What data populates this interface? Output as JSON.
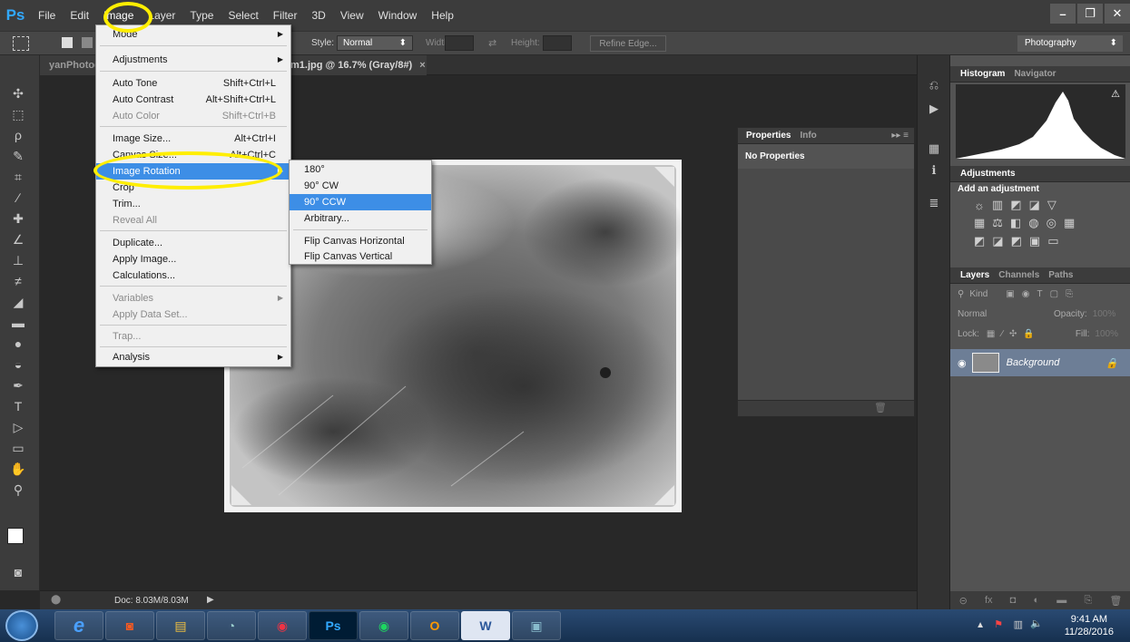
{
  "app": {
    "logo": "Ps"
  },
  "menubar": {
    "items": [
      "File",
      "Edit",
      "Image",
      "Layer",
      "Type",
      "Select",
      "Filter",
      "3D",
      "View",
      "Window",
      "Help"
    ]
  },
  "options": {
    "style_label": "Style:",
    "style_value": "Normal",
    "width_label": "Width:",
    "height_label": "Height:",
    "refine_label": "Refine Edge...",
    "workspace": "Photography"
  },
  "tabs": {
    "left_tab": "yanPhotograp",
    "doc_tab": "m1.jpg @ 16.7% (Gray/8#)"
  },
  "image_menu": {
    "mode": "Mode",
    "adjustments": "Adjustments",
    "auto_tone": "Auto Tone",
    "auto_tone_sc": "Shift+Ctrl+L",
    "auto_contrast": "Auto Contrast",
    "auto_contrast_sc": "Alt+Shift+Ctrl+L",
    "auto_color": "Auto Color",
    "auto_color_sc": "Shift+Ctrl+B",
    "image_size": "Image Size...",
    "image_size_sc": "Alt+Ctrl+I",
    "canvas_size": "Canvas Size...",
    "canvas_size_sc": "Alt+Ctrl+C",
    "image_rotation": "Image Rotation",
    "crop": "Crop",
    "trim": "Trim...",
    "reveal_all": "Reveal All",
    "duplicate": "Duplicate...",
    "apply_image": "Apply Image...",
    "calculations": "Calculations...",
    "variables": "Variables",
    "apply_data_set": "Apply Data Set...",
    "trap": "Trap...",
    "analysis": "Analysis"
  },
  "rotation_submenu": {
    "items": [
      "180°",
      "90° CW",
      "90° CCW",
      "Arbitrary...",
      "Flip Canvas Horizontal",
      "Flip Canvas Vertical"
    ],
    "highlighted": "90° CCW"
  },
  "properties_panel": {
    "tab1": "Properties",
    "tab2": "Info",
    "body": "No Properties"
  },
  "right_panels": {
    "histogram_tab": "Histogram",
    "navigator_tab": "Navigator",
    "adjustments_tab": "Adjustments",
    "adjustments_hint": "Add an adjustment",
    "layers_tab": "Layers",
    "channels_tab": "Channels",
    "paths_tab": "Paths",
    "kind_label": "Kind",
    "blend_mode": "Normal",
    "opacity_label": "Opacity:",
    "opacity_value": "100%",
    "lock_label": "Lock:",
    "fill_label": "Fill:",
    "fill_value": "100%",
    "layer_name": "Background"
  },
  "status": {
    "doc": "Doc: 8.03M/8.03M"
  },
  "taskbar": {
    "time": "9:41 AM",
    "date": "11/28/2016"
  },
  "colors": {
    "accent": "#3d8ee6",
    "highlight_ring": "#ffee00",
    "ps_blue": "#31a8ff"
  }
}
